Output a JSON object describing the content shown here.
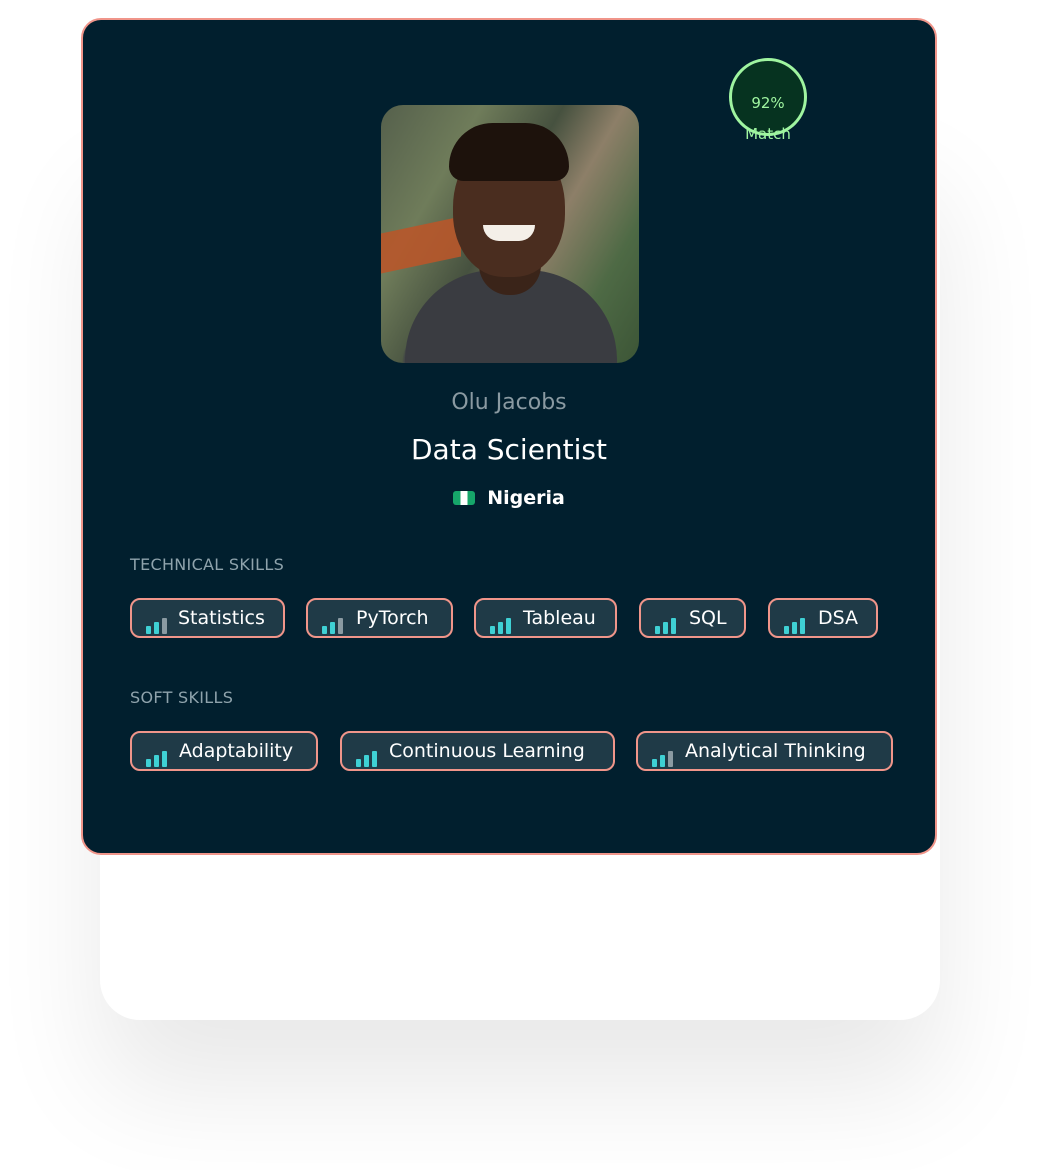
{
  "match": {
    "percent": "92%",
    "label": "Match"
  },
  "profile": {
    "name": "Olu Jacobs",
    "role": "Data Scientist",
    "country": "Nigeria"
  },
  "technical": {
    "title": "TECHNICAL SKILLS",
    "skills": [
      "Statistics",
      "PyTorch",
      "Tableau",
      "SQL",
      "DSA"
    ]
  },
  "soft": {
    "title": "SOFT SKILLS",
    "skills": [
      "Adaptability",
      "Continuous Learning",
      "Analytical Thinking"
    ]
  },
  "colors": {
    "card_bg": "#011f2e",
    "border_accent": "#f0958a",
    "match_green": "#9ff5a0",
    "bar_teal": "#3fd0d4",
    "bar_gray": "#8a9aa2"
  }
}
